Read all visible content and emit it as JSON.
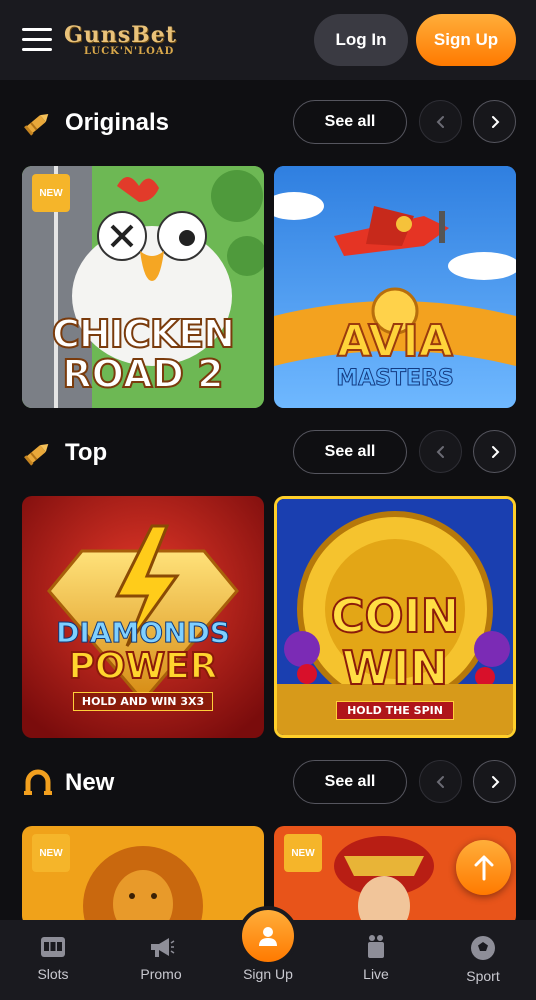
{
  "header": {
    "logo_main": "GunsBet",
    "logo_sub": "LUCK'N'LOAD",
    "login_label": "Log In",
    "signup_label": "Sign Up"
  },
  "sections": [
    {
      "title": "Originals",
      "see_all": "See all",
      "icon": "bullet-icon",
      "games": [
        {
          "title_line1": "CHICKEN",
          "title_line2": "ROAD 2",
          "badge": "NEW"
        },
        {
          "title_line1": "AVIA",
          "title_line2": "MASTERS",
          "badge": ""
        }
      ]
    },
    {
      "title": "Top",
      "see_all": "See all",
      "icon": "bullet-icon",
      "games": [
        {
          "title_line1": "DIAMONDS",
          "title_line2": "POWER",
          "subtitle": "HOLD AND WIN 3X3",
          "badge": ""
        },
        {
          "title_line1": "COIN",
          "title_line2": "WIN",
          "subtitle": "HOLD THE SPIN",
          "badge": ""
        }
      ]
    },
    {
      "title": "New",
      "see_all": "See all",
      "icon": "horseshoe-icon",
      "games": [
        {
          "badge": "NEW"
        },
        {
          "badge": "NEW"
        }
      ]
    }
  ],
  "bottom_nav": [
    {
      "label": "Slots",
      "icon": "slot-machine-icon"
    },
    {
      "label": "Promo",
      "icon": "megaphone-icon"
    },
    {
      "label": "Sign Up",
      "icon": "user-icon"
    },
    {
      "label": "Live",
      "icon": "cards-icon"
    },
    {
      "label": "Sport",
      "icon": "soccer-ball-icon"
    }
  ],
  "colors": {
    "accent": "#ff8a00",
    "background": "#0f0f12",
    "bar": "#1a1a1f"
  }
}
